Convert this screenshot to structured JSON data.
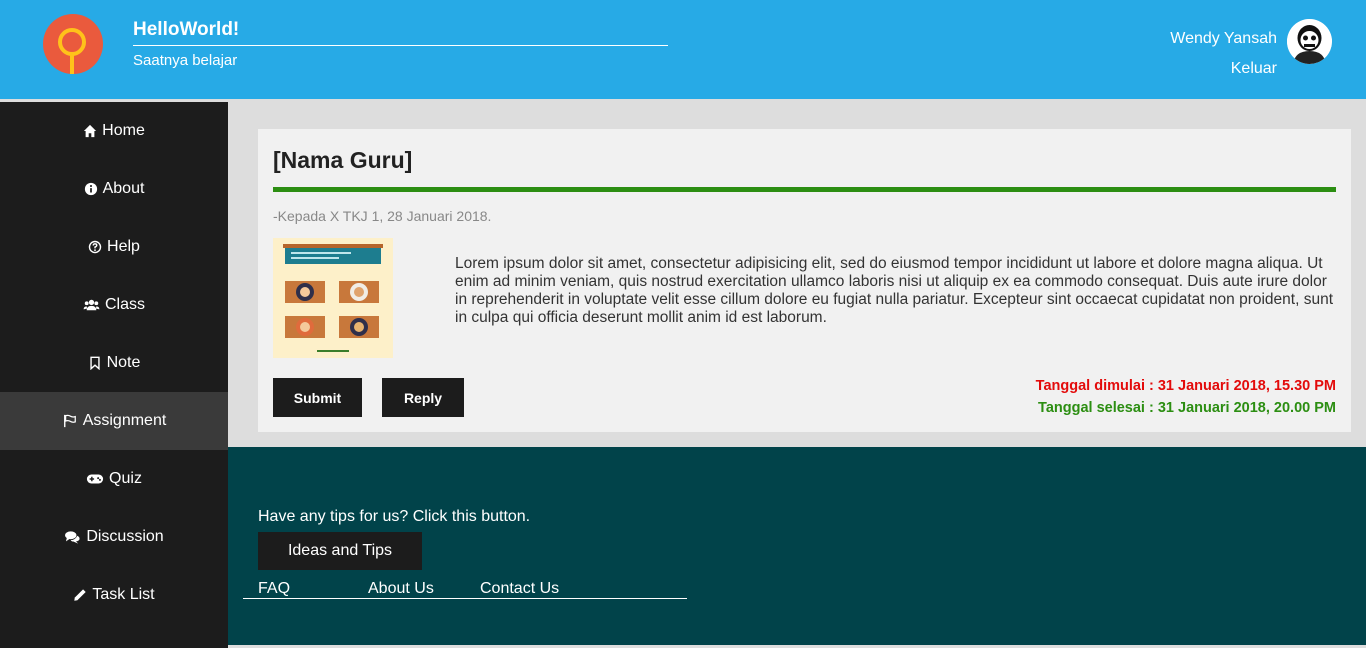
{
  "header": {
    "title": "HelloWorld!",
    "subtitle": "Saatnya belajar",
    "user_name": "Wendy Yansah",
    "logout_label": "Keluar"
  },
  "sidebar": {
    "items": [
      {
        "label": "Home",
        "icon": "home-icon"
      },
      {
        "label": "About",
        "icon": "info-icon"
      },
      {
        "label": "Help",
        "icon": "question-icon"
      },
      {
        "label": "Class",
        "icon": "users-icon"
      },
      {
        "label": "Note",
        "icon": "bookmark-icon"
      },
      {
        "label": "Assignment",
        "icon": "flag-icon",
        "active": true
      },
      {
        "label": "Quiz",
        "icon": "gamepad-icon"
      },
      {
        "label": "Discussion",
        "icon": "comments-icon"
      },
      {
        "label": "Task List",
        "icon": "pencil-icon"
      }
    ]
  },
  "post": {
    "title": "[Nama Guru]",
    "meta": "-Kepada X TKJ 1, 28 Januari 2018.",
    "body": "Lorem ipsum dolor sit amet, consectetur adipisicing elit, sed do eiusmod tempor incididunt ut labore et dolore magna aliqua. Ut enim ad minim veniam, quis nostrud exercitation ullamco laboris nisi ut aliquip ex ea commodo consequat. Duis aute irure dolor in reprehenderit in voluptate velit esse cillum dolore eu fugiat nulla pariatur. Excepteur sint occaecat cupidatat non proident, sunt in culpa qui officia deserunt mollit anim id est laborum.",
    "submit_label": "Submit",
    "reply_label": "Reply",
    "start_date": "Tanggal dimulai : 31 Januari 2018, 15.30 PM",
    "end_date": "Tanggal selesai : 31 Januari 2018, 20.00 PM"
  },
  "footer": {
    "tip": "Have any tips for us? Click this button.",
    "tips_button": "Ideas and Tips",
    "links": [
      "FAQ",
      "About Us",
      "Contact Us"
    ]
  },
  "colors": {
    "header_bg": "#27aae6",
    "sidebar_bg": "#1c1c1c",
    "footer_bg": "#01434a",
    "accent_green": "#2c8e12",
    "accent_red": "#e30b0b"
  }
}
